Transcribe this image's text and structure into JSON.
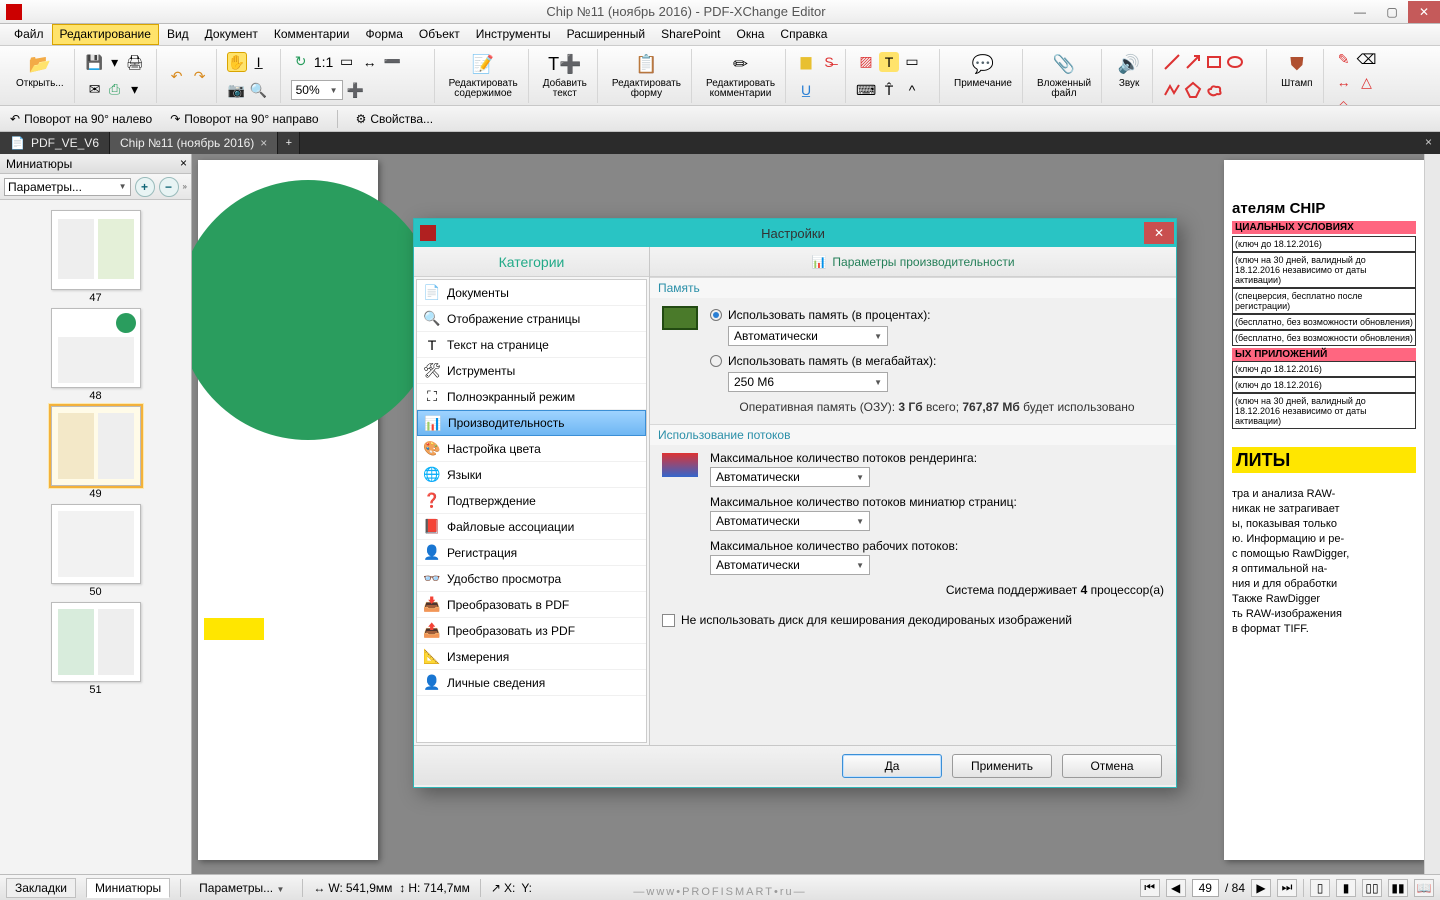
{
  "title": "Chip №11 (ноябрь 2016) - PDF-XChange Editor",
  "menu": [
    "Файл",
    "Редактирование",
    "Вид",
    "Документ",
    "Комментарии",
    "Форма",
    "Объект",
    "Инструменты",
    "Расширенный",
    "SharePoint",
    "Окна",
    "Справка"
  ],
  "menu_highlight_index": 1,
  "ribbon": {
    "open": "Открыть...",
    "zoom": "50%",
    "edit_content": "Редактировать\nсодержимое",
    "add_text": "Добавить\nтекст",
    "edit_form": "Редактировать\nформу",
    "edit_comments": "Редактировать\nкомментарии",
    "note": "Примечание",
    "attach": "Вложенный\nфайл",
    "sound": "Звук",
    "stamp": "Штамп"
  },
  "rotate": {
    "left": "Поворот на 90° налево",
    "right": "Поворот на 90° направо",
    "props": "Свойства..."
  },
  "tabs": [
    {
      "label": "PDF_VE_V6"
    },
    {
      "label": "Chip №11 (ноябрь 2016)"
    }
  ],
  "thumbnails": {
    "title": "Миниатюры",
    "params": "Параметры...",
    "pages": [
      "47",
      "48",
      "49",
      "50",
      "51"
    ],
    "selected": "49"
  },
  "dialog": {
    "title": "Настройки",
    "cats_header": "Категории",
    "right_header": "Параметры производительности",
    "categories": [
      "Документы",
      "Отображение страницы",
      "Текст на странице",
      "Иструменты",
      "Полноэкранный режим",
      "Производительность",
      "Настройка цвета",
      "Языки",
      "Подтверждение",
      "Файловые ассоциации",
      "Регистрация",
      "Удобство просмотра",
      "Преобразовать в PDF",
      "Преобразовать из PDF",
      "Измерения",
      "Личные сведения"
    ],
    "categories_selected_index": 5,
    "memory": {
      "header": "Память",
      "opt_percent": "Использовать память (в процентах):",
      "opt_percent_value": "Автоматически",
      "opt_mb": "Использовать память (в мегабайтах):",
      "opt_mb_value": "250 M6",
      "ram_prefix": "Оперативная память (ОЗУ): ",
      "ram_total": "3 Гб",
      "ram_mid": " всего; ",
      "ram_used": "767,87 Мб",
      "ram_suffix": " будет использовано"
    },
    "threads": {
      "header": "Использование потоков",
      "render_label": "Максимальное количество потоков рендеринга:",
      "render_value": "Автоматически",
      "thumb_label": "Максимальное количество потоков миниатюр страниц:",
      "thumb_value": "Автоматически",
      "work_label": "Максимальное количество рабочих потоков:",
      "work_value": "Автоматически",
      "cpu_prefix": "Система поддерживает ",
      "cpu_n": "4",
      "cpu_suffix": " процессор(а)"
    },
    "no_disk_cache": "Не использовать диск для кеширования декодированых изображений",
    "ok": "Да",
    "apply": "Применить",
    "cancel": "Отмена"
  },
  "status": {
    "bookmarks": "Закладки",
    "thumbs": "Миниатюры",
    "params": "Параметры...",
    "w_label": "W:",
    "w_val": "541,9мм",
    "h_label": "H:",
    "h_val": "714,7мм",
    "x_label": "X:",
    "y_label": "Y:",
    "page_cur": "49",
    "page_total": "/ 84",
    "watermark": "—www•PROFISMART•ru—"
  },
  "bg_text": {
    "chip_header": "ателям CHIP",
    "pink_header": "ЦИАЛЬНЫХ УСЛОВИЯХ",
    "row1": "(ключ до 18.12.2016)",
    "row2": "(ключ на 30 дней, валидный до 18.12.2016 независимо от даты активации)",
    "row3": "(спецверсия, бесплатно после регистрации)",
    "row4": "(бесплатно, без возможности обновления)",
    "row5": "(бесплатно, без возможности обновления)",
    "pink_header2": "ЫХ ПРИЛОЖЕНИЙ",
    "row6": "(ключ до 18.12.2016)",
    "row7": "(ключ до 18.12.2016)",
    "row8": "(ключ на 30 дней, валидный до 18.12.2016 независимо от даты активации)",
    "yellow": "ЛИТЫ",
    "body": "тра и анализа RAW-\nникак не затрагивает\nы, показывая только\nю. Информацию и ре-\nс помощью RawDigger,\nя оптимальной на-\nния и для обработки\nТакже RawDigger\nть RAW-изображения\nв формат TIFF."
  }
}
